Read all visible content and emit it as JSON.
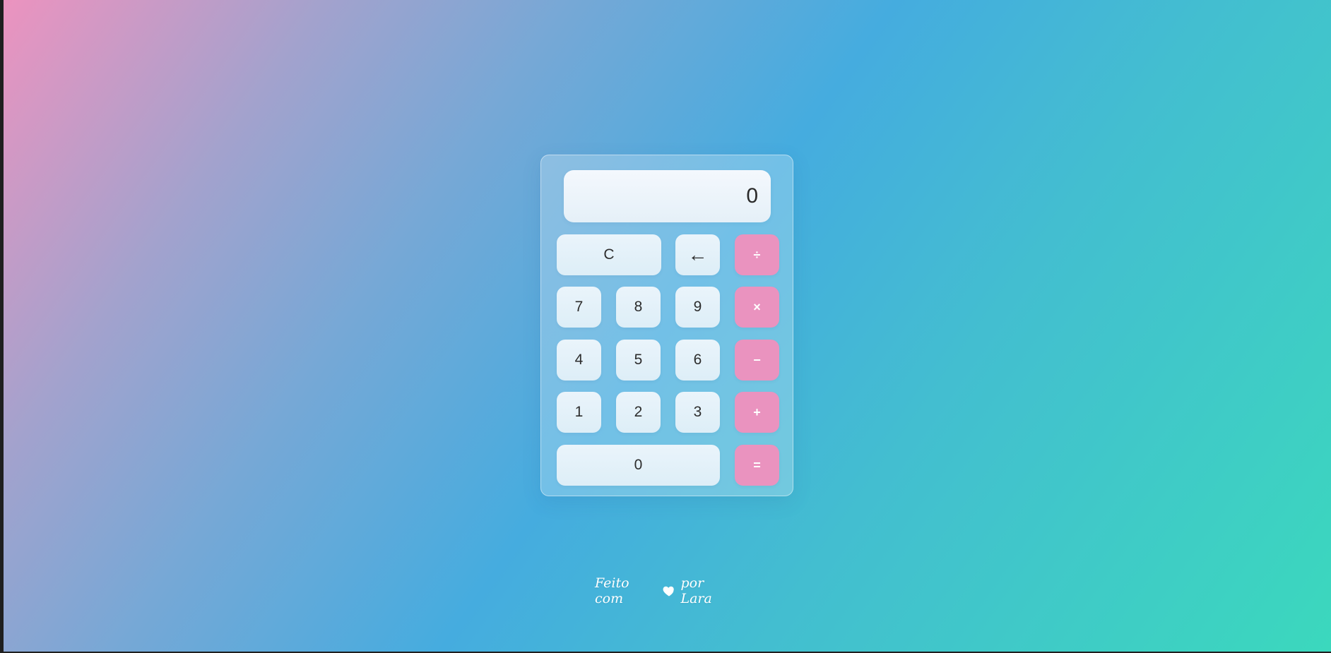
{
  "display": {
    "value": "0"
  },
  "keys": {
    "clear": "C",
    "backspace": "←",
    "divide": "÷",
    "seven": "7",
    "eight": "8",
    "nine": "9",
    "multiply": "×",
    "four": "4",
    "five": "5",
    "six": "6",
    "subtract": "−",
    "one": "1",
    "two": "2",
    "three": "3",
    "add": "+",
    "zero": "0",
    "equals": "="
  },
  "footer": {
    "before_heart": "Feito com",
    "heart_icon": "heart-icon",
    "after_heart": "por Lara"
  },
  "colors": {
    "operator": "#ea93bf",
    "gradient_start": "#ec93bf",
    "gradient_mid": "#45acdf",
    "gradient_end": "#3bd8bd"
  }
}
